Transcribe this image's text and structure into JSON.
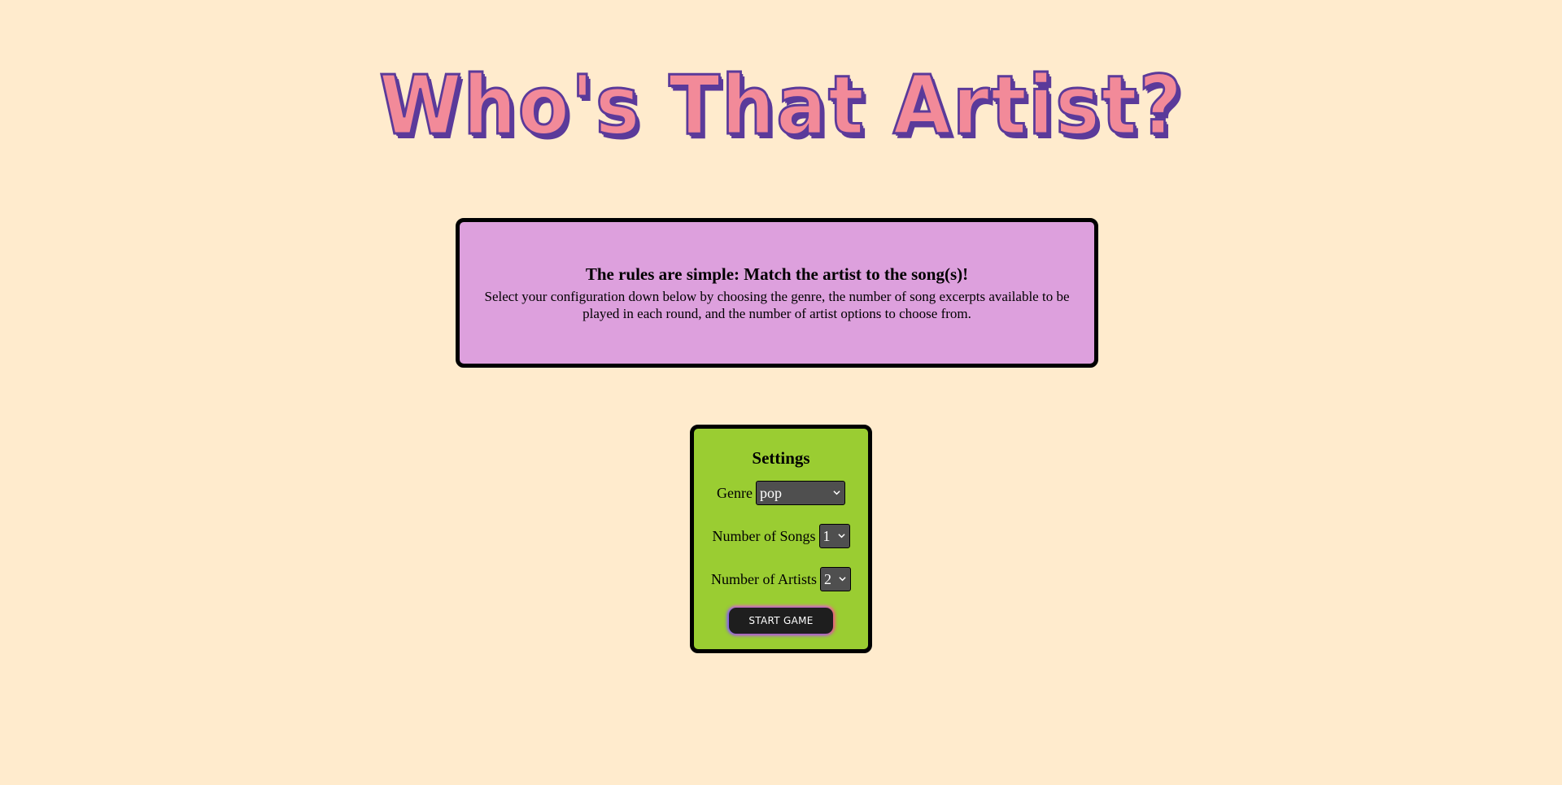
{
  "title": "Who's That Artist?",
  "rules": {
    "heading": "The rules are simple: Match the artist to the song(s)!",
    "text": "Select your configuration down below by choosing the genre, the number of song excerpts available to be played in each round, and the number of artist options to choose from."
  },
  "settings": {
    "title": "Settings",
    "genre_label": "Genre",
    "genre_value": "pop",
    "songs_label": "Number of Songs",
    "songs_value": "1",
    "artists_label": "Number of Artists",
    "artists_value": "2",
    "start_label": "START GAME"
  },
  "colors": {
    "background": "#ffebcd",
    "title_fill": "#f28a99",
    "title_outline": "#5b3a9a",
    "rules_box": "#dda0dd",
    "settings_box": "#9acd32",
    "select_bg": "#4f4f4f",
    "button_bg": "#1e1e1e"
  },
  "icons": {
    "select_caret": "chevron-down-icon"
  }
}
